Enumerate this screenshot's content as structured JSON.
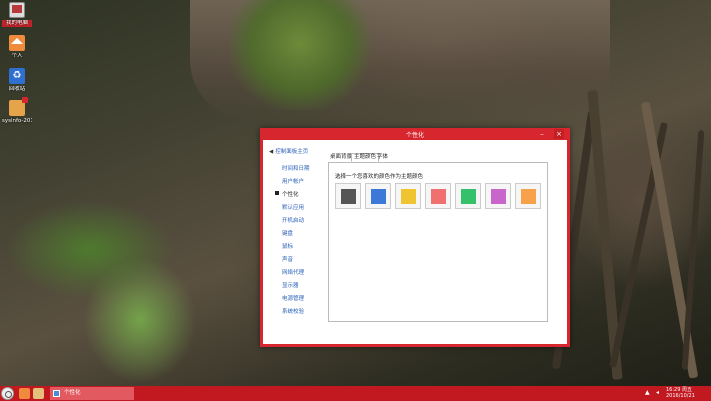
{
  "desktop": {
    "icons": [
      {
        "label": "我的电脑",
        "icon": "computer-icon",
        "selected": true
      },
      {
        "label": "个人",
        "icon": "home-folder-icon"
      },
      {
        "label": "回收站",
        "icon": "recycle-bin-icon"
      },
      {
        "label": "sysinfo-2016107...",
        "icon": "package-icon"
      }
    ]
  },
  "window": {
    "title": "个性化",
    "minimize": "–",
    "close": "×",
    "nav": {
      "back": "控制面板主页",
      "items": [
        "时间和日期",
        "用户帐户",
        "个性化",
        "默认应用",
        "开机启动",
        "键盘",
        "鼠标",
        "声音",
        "网络代理",
        "显示器",
        "电源管理",
        "系统校验"
      ],
      "current_index": 2
    },
    "tabs": [
      "桌面背景",
      "主题颜色",
      "字体"
    ],
    "active_tab": 1,
    "panel_label": "选择一个您喜欢的颜色作为主题颜色",
    "swatches": [
      "#555555",
      "#3c78d8",
      "#f0c431",
      "#f07070",
      "#35c16a",
      "#c866cc",
      "#f7a24a"
    ]
  },
  "taskbar": {
    "task_label": "个性化",
    "clock_time": "16:29 周五",
    "clock_date": "2016/10/21"
  },
  "colors": {
    "accent": "#d7262d",
    "taskbar": "#c2181f",
    "link": "#2a60b8"
  }
}
